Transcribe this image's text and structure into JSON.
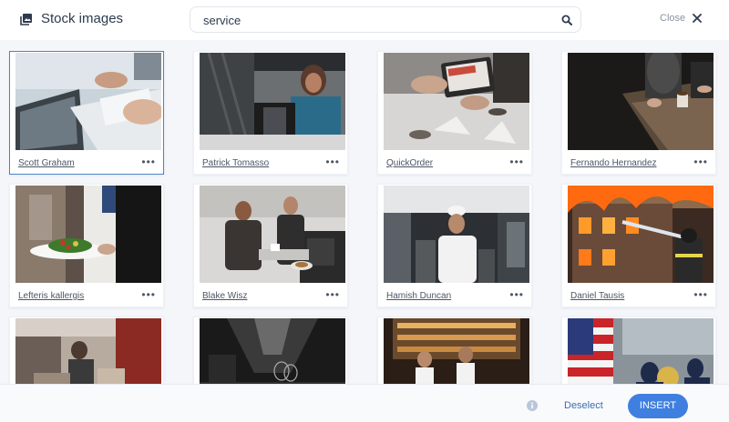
{
  "header": {
    "title": "Stock images",
    "title_icon": "image-icon",
    "search_value": "service",
    "search_icon": "search-icon",
    "close_label": "Close",
    "close_icon": "close-icon"
  },
  "images": [
    {
      "author": "Scott Graham",
      "selected": true
    },
    {
      "author": "Patrick Tomasso",
      "selected": false
    },
    {
      "author": "QuickOrder",
      "selected": false
    },
    {
      "author": "Fernando Hernandez",
      "selected": false
    },
    {
      "author": "Lefteris kallergis",
      "selected": false
    },
    {
      "author": "Blake Wisz",
      "selected": false
    },
    {
      "author": "Hamish Duncan",
      "selected": false
    },
    {
      "author": "Daniel Tausis",
      "selected": false
    },
    {
      "author": "",
      "selected": false
    },
    {
      "author": "",
      "selected": false
    },
    {
      "author": "",
      "selected": false
    },
    {
      "author": "",
      "selected": false
    }
  ],
  "more_label": "•••",
  "footer": {
    "info_icon": "info-icon",
    "deselect_label": "Deselect",
    "insert_label": "INSERT"
  },
  "colors": {
    "accent": "#3f7fe0",
    "selected_border": "#4d82c9",
    "link": "#3c6db0"
  }
}
